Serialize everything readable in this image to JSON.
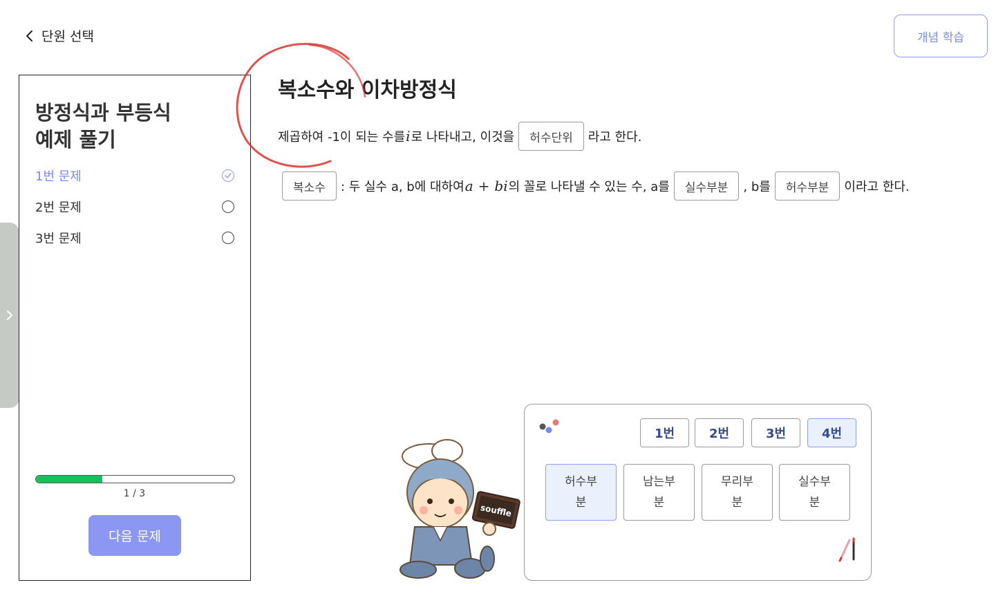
{
  "header": {
    "back_label": "단원 선택",
    "concept_button": "개념 학습"
  },
  "sidebar": {
    "title_line1": "방정식과 부등식",
    "title_line2": "예제 풀기",
    "questions": [
      {
        "label": "1번 문제",
        "completed": true
      },
      {
        "label": "2번 문제",
        "completed": false
      },
      {
        "label": "3번 문제",
        "completed": false
      }
    ],
    "progress": {
      "current": 1,
      "total": 3,
      "text": "1 / 3"
    },
    "next_button": "다음 문제"
  },
  "content": {
    "title": "복소수와 이차방정식",
    "line1": {
      "text_before": "제곱하여 -1이 되는 수를 ",
      "math_i": "i",
      "text_middle": "로 나타내고, 이것을",
      "blank": "허수단위",
      "text_after": "라고 한다."
    },
    "line2": {
      "blank1": "복소수",
      "text1": ": 두 실수 a, b에 대하여 ",
      "math_a": "a",
      "math_plus": "+",
      "math_bi": "bi",
      "text2": "의 꼴로 나타낼 수 있는 수, a를",
      "blank2": "실수부분",
      "text3": ", b를",
      "blank3": "허수부분",
      "text4": "이라고 한다."
    }
  },
  "answer_panel": {
    "number_tabs": [
      "1번",
      "2번",
      "3번",
      "4번"
    ],
    "selected_tab": "4번",
    "choices": [
      "허수부분",
      "남는부분",
      "무리부분",
      "실수부분"
    ],
    "selected_choice": "허수부분",
    "mascot_sign": "souffle"
  },
  "colors": {
    "accent": "#8b97f2",
    "progress": "#14c15a",
    "selected_bg": "#eaf0fc",
    "annotation_red": "#d9342f"
  },
  "icons": [
    "chevron-left-icon",
    "chevron-right-icon",
    "check-icon",
    "dots-icon",
    "pen-icon"
  ]
}
